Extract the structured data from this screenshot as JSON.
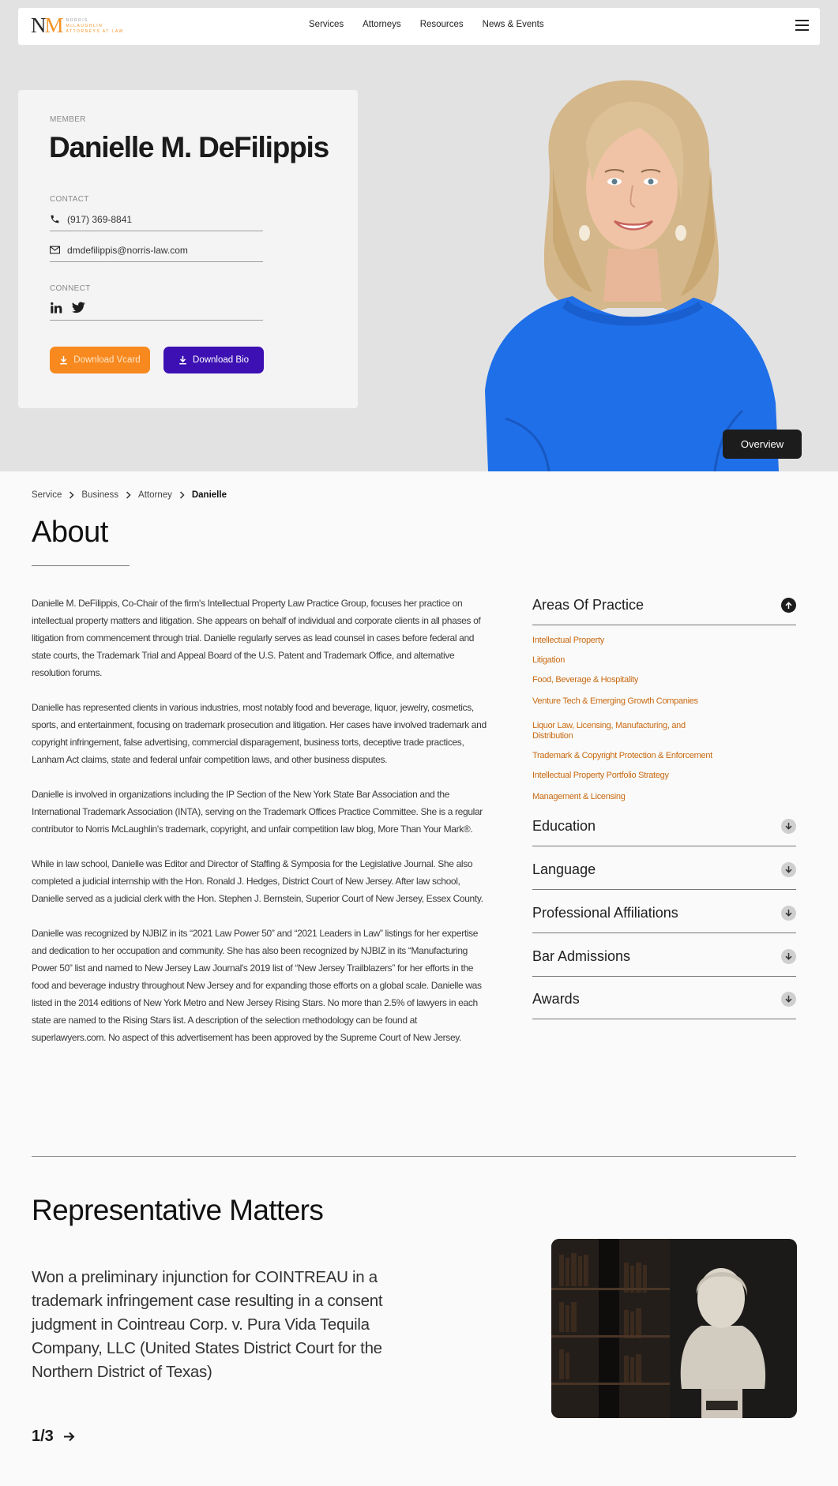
{
  "nav": {
    "logo_initials_n": "N",
    "logo_initials_m": "M",
    "logo_line1": "NORRIS",
    "logo_line2": "McLAUGHLIN",
    "logo_line3": "ATTORNEYS AT LAW",
    "links": [
      "Services",
      "Attorneys",
      "Resources",
      "News & Events"
    ]
  },
  "profile": {
    "eyebrow": "MEMBER",
    "name": "Danielle M. DeFilippis",
    "contact_label": "CONTACT",
    "phone": "(917) 369-8841",
    "email": "dmdefilippis@norris-law.com",
    "connect_label": "CONNECT",
    "vcard_label": "Download Vcard",
    "bio_label": "Download Bio",
    "overview_label": "Overview"
  },
  "breadcrumb": [
    "Service",
    "Business",
    "Attorney",
    "Danielle"
  ],
  "about": {
    "title": "About",
    "paragraphs": [
      "Danielle M. DeFilippis, Co-Chair of the firm's Intellectual Property Law Practice Group, focuses her practice on intellectual property matters and litigation. She appears on behalf of individual and corporate clients in all phases of litigation from commencement through trial.  Danielle regularly serves as lead counsel in cases before federal and state courts, the Trademark Trial and Appeal Board of the U.S. Patent and Trademark Office, and alternative resolution forums.",
      "Danielle has represented clients in various industries, most notably food and beverage, liquor, jewelry, cosmetics, sports, and entertainment, focusing on trademark prosecution and litigation. Her cases have involved trademark and copyright infringement, false advertising, commercial disparagement, business torts, deceptive trade practices, Lanham Act claims, state and federal unfair competition laws, and other business disputes.",
      "Danielle is involved in organizations including the IP Section of the New York State Bar Association and the International Trademark Association (INTA), serving on the Trademark Offices Practice Committee. She is a regular contributor to Norris McLaughlin's trademark, copyright, and unfair competition law blog, More Than Your Mark®.",
      "While in law school, Danielle was Editor and Director of Staffing & Symposia for the Legislative Journal. She also completed a judicial internship with the Hon. Ronald J. Hedges, District Court of New Jersey. After law school, Danielle served as a judicial clerk with the Hon. Stephen J. Bernstein, Superior Court of New Jersey, Essex County.",
      "Danielle was recognized by NJBIZ in its “2021 Law Power 50” and “2021 Leaders in Law” listings for her expertise and dedication to her occupation and community. She has also been recognized by NJBIZ in its “Manufacturing Power 50” list and named to New Jersey Law Journal's 2019 list of “New Jersey Trailblazers” for her efforts in the food and beverage industry throughout New Jersey and for expanding those efforts on a global scale. Danielle was listed in the 2014 editions of New York Metro and New Jersey Rising Stars. No more than 2.5% of lawyers in each state are named to the Rising Stars list. A description of the selection methodology can be found at superlawyers.com. No aspect of this advertisement has been approved by the Supreme Court of New Jersey."
    ]
  },
  "sidebar": {
    "practice_title": "Areas Of Practice",
    "practice_items": [
      "Intellectual Property",
      "Litigation",
      "Food, Beverage & Hospitality",
      "Venture Tech & Emerging Growth Companies",
      "Liquor Law, Licensing, Manufacturing, and",
      "Distribution",
      "Trademark & Copyright Protection & Enforcement",
      "Intellectual Property Portfolio Strategy",
      "Management & Licensing"
    ],
    "sections": [
      "Education",
      "Language",
      "Professional Affiliations",
      "Bar Admissions",
      "Awards"
    ]
  },
  "matters": {
    "title": "Representative Matters",
    "text": "Won a preliminary injunction for COINTREAU in a trademark infringement case resulting in a consent judgment in Cointreau Corp. v. Pura Vida Tequila Company, LLC (United States District Court for the Northern District of Texas)",
    "pager": "1/3"
  },
  "colors": {
    "accent_orange": "#f7891f",
    "accent_purple": "#3c10b2",
    "practice_link": "#c86a12",
    "dress_blue": "#1f6fe8"
  }
}
